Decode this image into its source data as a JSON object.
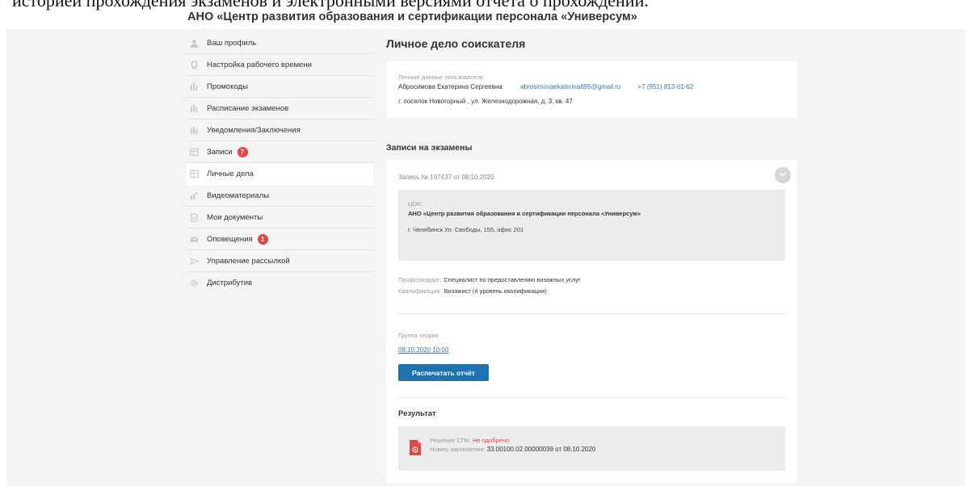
{
  "doc_caption": "историей прохождения экзаменов и электронными версиями отчета о прохождении.",
  "org_title": "АНО «Центр развития образования и сертификации персонала «Универсум»",
  "sidebar": {
    "items": [
      {
        "label": "Ваш профиль",
        "icon": "user-icon"
      },
      {
        "label": "Настройка рабочего времени",
        "icon": "location-pin-icon"
      },
      {
        "label": "Промокоды",
        "icon": "columns-icon"
      },
      {
        "label": "Расписание экзаменов",
        "icon": "columns-icon"
      },
      {
        "label": "Уведомления/Заключения",
        "icon": "columns-icon"
      },
      {
        "label": "Записи",
        "icon": "records-icon",
        "badge": "7"
      },
      {
        "label": "Личные дела",
        "icon": "records-icon",
        "active": true
      },
      {
        "label": "Видеоматериалы",
        "icon": "video-icon"
      },
      {
        "label": "Мои документы",
        "icon": "document-icon"
      },
      {
        "label": "Оповещения",
        "icon": "mail-icon",
        "badge": "1"
      },
      {
        "label": "Управление рассылкой",
        "icon": "send-icon"
      },
      {
        "label": "Дистрибутив",
        "icon": "gear-icon"
      }
    ]
  },
  "page_title": "Личное дело соискателя",
  "personal": {
    "label": "Личные данные пользователя",
    "name": "Абросимова Екатерина Сергеевна",
    "email": "abrosimovaekaterina695@gmail.ru",
    "phone": "+7 (951) 813-61-62",
    "address": "г. поселок Новогорный , ул. Железнодорожная, д. 3, кв. 47"
  },
  "exams_title": "Записи на экзамены",
  "record": {
    "header": "Запись № 197437 от 08.10.2020",
    "tsok_label": "ЦОК:",
    "tsok_name": "АНО «Центр развития образования и сертификации персонала «Универсум»",
    "tsok_address": "г. Челябинск Ул. Свободы, 155, офис 201",
    "profstandard_key": "Профстандарт:",
    "profstandard_value": "Специалист по предоставлению визажных услуг",
    "qualification_key": "Квалификация:",
    "qualification_value": "Визажист (4 уровень квалификации)",
    "group_label": "Группа теории",
    "group_date": "08.10.2020 10:00",
    "print_button": "Распечатать отчёт",
    "result_title": "Результат",
    "decision_key": "Решение СПК:",
    "decision_value": "Не одобрено",
    "conclusion_key": "Номер заключения:",
    "conclusion_value": "33.00100.02.00000039 от 08.10.2020"
  },
  "colors": {
    "accent": "#1f72b2",
    "link": "#3a78b5",
    "badge": "#e04848",
    "background": "#f4f4f4"
  }
}
